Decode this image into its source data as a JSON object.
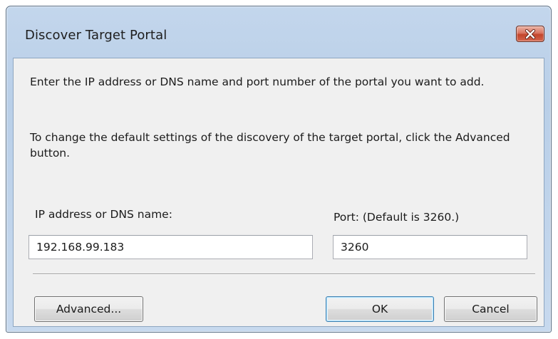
{
  "window": {
    "title": "Discover Target Portal"
  },
  "instructions": {
    "line1": "Enter the IP address or DNS name and port number of the portal you want to add.",
    "line2": "To change the default settings of the discovery of the target portal, click the Advanced button."
  },
  "form": {
    "ip_label": "IP address or DNS name:",
    "ip_value": "192.168.99.183",
    "port_label": "Port: (Default is 3260.)",
    "port_value": "3260"
  },
  "buttons": {
    "advanced": "Advanced...",
    "ok": "OK",
    "cancel": "Cancel"
  },
  "icons": {
    "close": "close-icon"
  },
  "colors": {
    "titlebar": "#b9cfe8",
    "close_button": "#c3452b",
    "dialog_body": "#f0f0f0",
    "default_button_border": "#3c7fb1"
  }
}
